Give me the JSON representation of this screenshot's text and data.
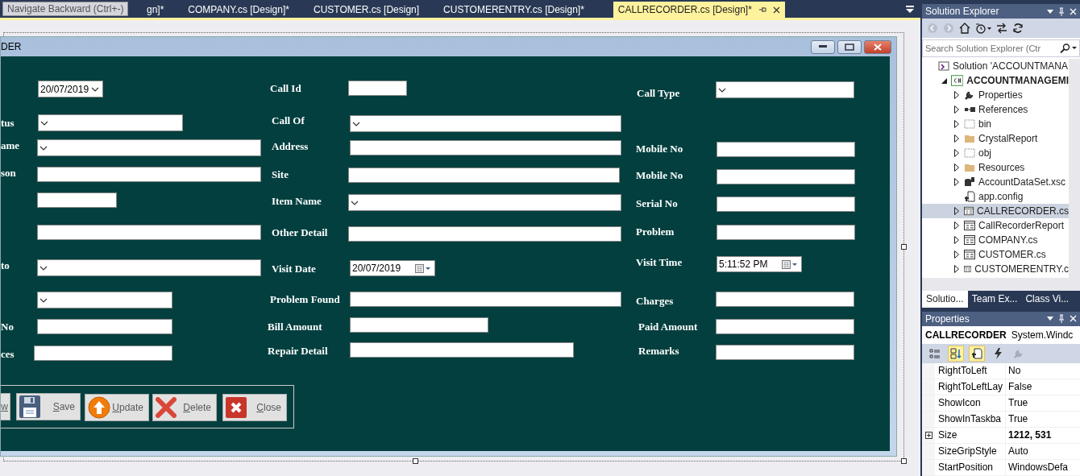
{
  "tooltip": {
    "text": "Navigate Backward (Ctrl+-)"
  },
  "document_tabs": [
    {
      "label": "gn]*",
      "selected": false
    },
    {
      "label": "COMPANY.cs [Design]*",
      "selected": false
    },
    {
      "label": "CUSTOMER.cs [Design]",
      "selected": false
    },
    {
      "label": "CUSTOMERENTRY.cs [Design]*",
      "selected": false
    },
    {
      "label": "CALLRECORDER.cs [Design]*",
      "selected": true
    }
  ],
  "form": {
    "title": "DER",
    "controls": [
      {
        "kind": "combobox",
        "value": "20/07/2019"
      },
      {
        "kind": "label",
        "text": "tus"
      },
      {
        "kind": "combobox"
      },
      {
        "kind": "label",
        "text": "ame"
      },
      {
        "kind": "combobox"
      },
      {
        "kind": "label",
        "text": "son"
      },
      {
        "kind": "textbox"
      },
      {
        "kind": "textbox"
      },
      {
        "kind": "textbox"
      },
      {
        "kind": "label",
        "text": "to"
      },
      {
        "kind": "combobox"
      },
      {
        "kind": "combobox"
      },
      {
        "kind": "label",
        "text": "No"
      },
      {
        "kind": "textbox"
      },
      {
        "kind": "label",
        "text": "ces"
      },
      {
        "kind": "textbox"
      },
      {
        "kind": "label",
        "text": "Call Id"
      },
      {
        "kind": "textbox"
      },
      {
        "kind": "label",
        "text": "Call Of"
      },
      {
        "kind": "combobox"
      },
      {
        "kind": "label",
        "text": "Address"
      },
      {
        "kind": "textbox"
      },
      {
        "kind": "label",
        "text": "Site"
      },
      {
        "kind": "textbox"
      },
      {
        "kind": "label",
        "text": "Item Name"
      },
      {
        "kind": "combobox"
      },
      {
        "kind": "label",
        "text": "Other Detail"
      },
      {
        "kind": "textbox"
      },
      {
        "kind": "label",
        "text": "Visit Date"
      },
      {
        "kind": "datepicker",
        "value": "20/07/2019"
      },
      {
        "kind": "label",
        "text": "Problem Found"
      },
      {
        "kind": "textbox"
      },
      {
        "kind": "label",
        "text": "Bill Amount"
      },
      {
        "kind": "textbox"
      },
      {
        "kind": "label",
        "text": "Repair Detail"
      },
      {
        "kind": "textbox"
      },
      {
        "kind": "label",
        "text": "Call Type"
      },
      {
        "kind": "combobox"
      },
      {
        "kind": "label",
        "text": "Mobile No"
      },
      {
        "kind": "textbox"
      },
      {
        "kind": "label",
        "text": "Mobile No"
      },
      {
        "kind": "textbox"
      },
      {
        "kind": "label",
        "text": "Serial No"
      },
      {
        "kind": "textbox"
      },
      {
        "kind": "label",
        "text": "Problem"
      },
      {
        "kind": "textbox"
      },
      {
        "kind": "label",
        "text": "Visit Time"
      },
      {
        "kind": "datepicker",
        "value": "5:11:52 PM"
      },
      {
        "kind": "label",
        "text": "Charges"
      },
      {
        "kind": "textbox"
      },
      {
        "kind": "label",
        "text": "Paid Amount"
      },
      {
        "kind": "textbox"
      },
      {
        "kind": "label",
        "text": "Remarks"
      },
      {
        "kind": "textbox"
      }
    ],
    "buttons": [
      {
        "kind": "plain",
        "label": "w"
      },
      {
        "kind": "save",
        "label": "Save"
      },
      {
        "kind": "update",
        "label": "Update"
      },
      {
        "kind": "delete",
        "label": "Delete"
      },
      {
        "kind": "close",
        "label": "Close"
      }
    ]
  },
  "solution_explorer": {
    "title": "Solution Explorer",
    "search": {
      "placeholder": "Search Solution Explorer (Ctr"
    },
    "tree": [
      {
        "label": "Solution 'ACCOUNTMANA",
        "kind": "solution",
        "selected": false,
        "children": [
          {
            "label": "ACCOUNTMANAGEMI",
            "kind": "project",
            "expanded": true,
            "selected": false,
            "children": [
              {
                "label": "Properties",
                "kind": "wrench",
                "expanded": false,
                "selected": false
              },
              {
                "label": "References",
                "kind": "references",
                "expanded": false,
                "selected": false
              },
              {
                "label": "bin",
                "kind": "hidden-folder",
                "expanded": false,
                "selected": false
              },
              {
                "label": "CrystalReport",
                "kind": "folder",
                "expanded": false,
                "selected": false
              },
              {
                "label": "obj",
                "kind": "hidden-folder",
                "expanded": false,
                "selected": false
              },
              {
                "label": "Resources",
                "kind": "folder",
                "expanded": false,
                "selected": false
              },
              {
                "label": "AccountDataSet.xsc",
                "kind": "dataset",
                "expanded": false,
                "selected": false
              },
              {
                "label": "app.config",
                "kind": "config",
                "selected": false
              },
              {
                "label": "CALLRECORDER.cs",
                "kind": "form",
                "expanded": false,
                "selected": true
              },
              {
                "label": "CallRecorderReport",
                "kind": "form",
                "expanded": false,
                "selected": false
              },
              {
                "label": "COMPANY.cs",
                "kind": "form",
                "expanded": false,
                "selected": false
              },
              {
                "label": "CUSTOMER.cs",
                "kind": "form",
                "expanded": false,
                "selected": false
              },
              {
                "label": "CUSTOMERENTRY.c",
                "kind": "form",
                "expanded": false,
                "selected": false
              }
            ]
          }
        ]
      }
    ],
    "tabs": [
      {
        "label": "Solutio...",
        "selected": true
      },
      {
        "label": "Team Ex...",
        "selected": false
      },
      {
        "label": "Class Vi...",
        "selected": false
      }
    ]
  },
  "properties": {
    "title": "Properties",
    "object_name": "CALLRECORDER",
    "object_type": "System.Windc",
    "toolbar": [
      {
        "kind": "categorized",
        "selected": false
      },
      {
        "kind": "alphabetical",
        "selected": true
      },
      {
        "kind": "property-pages",
        "selected": true
      },
      {
        "kind": "events",
        "selected": false
      },
      {
        "kind": "wrench",
        "selected": false
      }
    ],
    "rows": [
      {
        "name": "RightToLeft",
        "value": "No",
        "modified": false,
        "expandable": false
      },
      {
        "name": "RightToLeftLay",
        "value": "False",
        "modified": false,
        "expandable": false
      },
      {
        "name": "ShowIcon",
        "value": "True",
        "modified": false,
        "expandable": false
      },
      {
        "name": "ShowInTaskba",
        "value": "True",
        "modified": false,
        "expandable": false
      },
      {
        "name": "Size",
        "value": "1212, 531",
        "modified": true,
        "expandable": true
      },
      {
        "name": "SizeGripStyle",
        "value": "Auto",
        "modified": false,
        "expandable": false
      },
      {
        "name": "StartPosition",
        "value": "WindowsDefa",
        "modified": false,
        "expandable": false
      }
    ]
  }
}
